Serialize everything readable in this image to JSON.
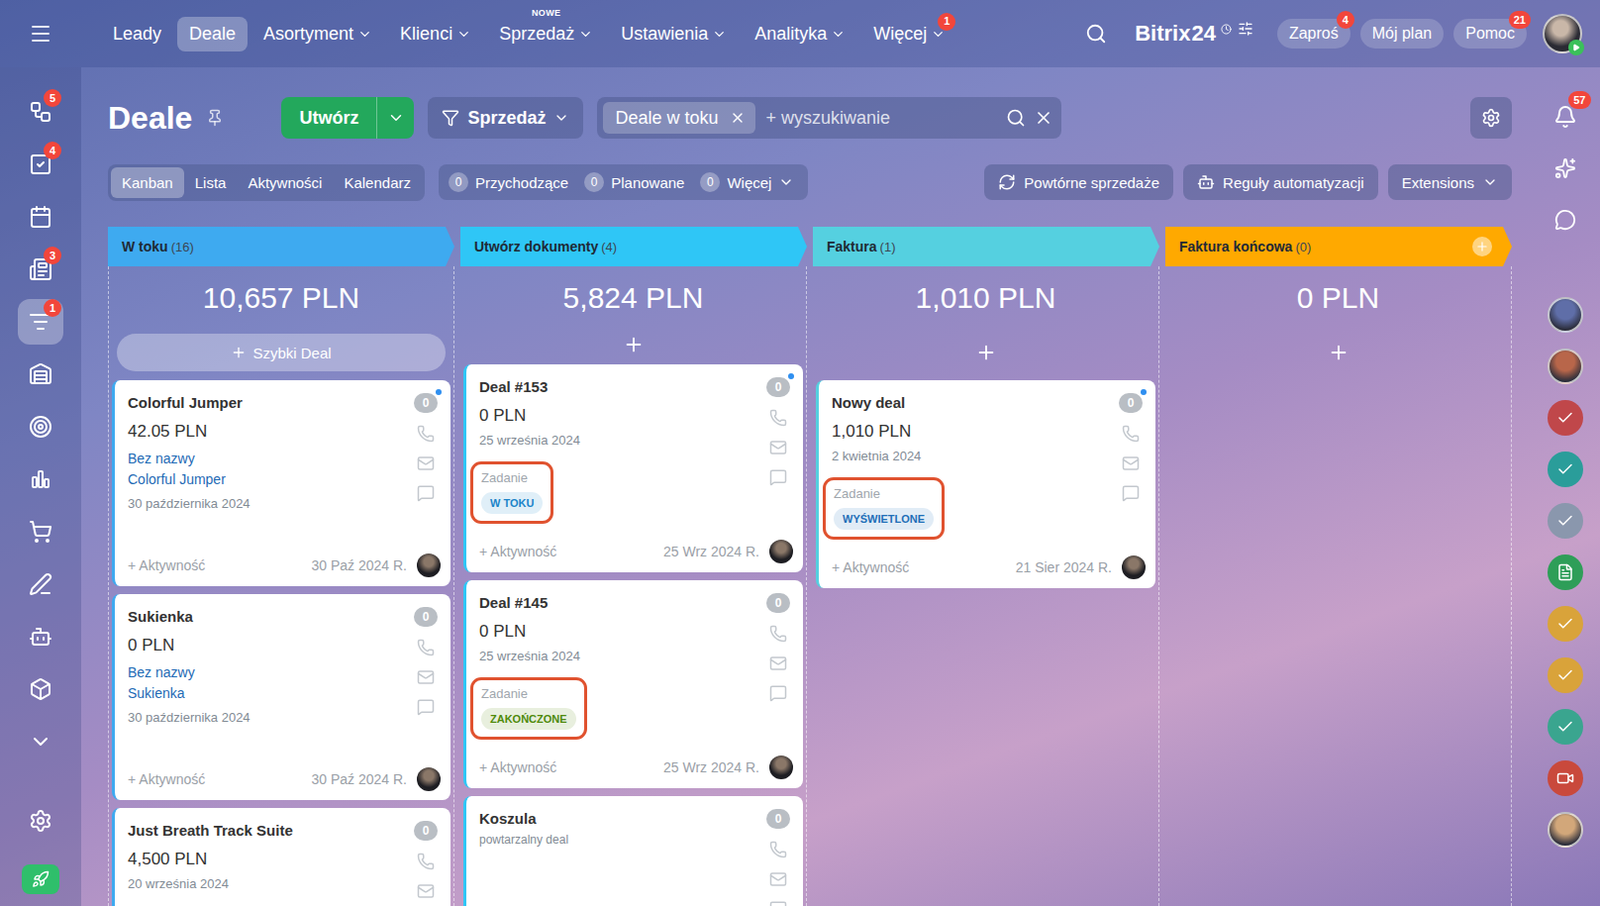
{
  "topbar": {
    "nav": [
      {
        "label": "Leady",
        "selected": false,
        "dropdown": false,
        "tag": "",
        "badge": ""
      },
      {
        "label": "Deale",
        "selected": true,
        "dropdown": false,
        "tag": "",
        "badge": ""
      },
      {
        "label": "Asortyment",
        "selected": false,
        "dropdown": true,
        "tag": "",
        "badge": ""
      },
      {
        "label": "Klienci",
        "selected": false,
        "dropdown": true,
        "tag": "",
        "badge": ""
      },
      {
        "label": "Sprzedaż",
        "selected": false,
        "dropdown": true,
        "tag": "NOWE",
        "badge": ""
      },
      {
        "label": "Ustawienia",
        "selected": false,
        "dropdown": true,
        "tag": "",
        "badge": ""
      },
      {
        "label": "Analityka",
        "selected": false,
        "dropdown": true,
        "tag": "",
        "badge": ""
      },
      {
        "label": "Więcej",
        "selected": false,
        "dropdown": true,
        "tag": "",
        "badge": "1"
      }
    ],
    "logo": {
      "name": "Bitrix",
      "number": "24"
    },
    "buttons": [
      {
        "label": "Zaproś",
        "badge": "4"
      },
      {
        "label": "Mój plan",
        "badge": ""
      },
      {
        "label": "Pomoc",
        "badge": "21"
      }
    ],
    "avatar_online": true
  },
  "sidebar": {
    "items": [
      {
        "badge": "5",
        "selected": false
      },
      {
        "badge": "4",
        "selected": false
      },
      {
        "badge": "",
        "selected": false
      },
      {
        "badge": "3",
        "selected": false
      },
      {
        "badge": "1",
        "selected": true
      },
      {
        "badge": "",
        "selected": false
      },
      {
        "badge": "",
        "selected": false
      },
      {
        "badge": "",
        "selected": false
      },
      {
        "badge": "",
        "selected": false
      },
      {
        "badge": "",
        "selected": false
      },
      {
        "badge": "",
        "selected": false
      },
      {
        "badge": "",
        "selected": false
      },
      {
        "badge": "",
        "selected": false
      }
    ]
  },
  "right_sidebar": {
    "top": [
      {
        "kind": "bell",
        "badge": "57"
      },
      {
        "kind": "copilot",
        "badge": ""
      },
      {
        "kind": "chat",
        "badge": ""
      }
    ],
    "items": [
      {
        "kind": "avatar",
        "color": "#5f6ea8"
      },
      {
        "kind": "avatar",
        "color": "#b8664a"
      },
      {
        "kind": "task",
        "color": "#c0474a"
      },
      {
        "kind": "task",
        "color": "#2a9d9a"
      },
      {
        "kind": "task",
        "color": "#8a97ad"
      },
      {
        "kind": "doc",
        "color": "#2e9e58"
      },
      {
        "kind": "task",
        "color": "#d9a33a"
      },
      {
        "kind": "task",
        "color": "#d9a33a"
      },
      {
        "kind": "task",
        "color": "#3aa58f"
      },
      {
        "kind": "video",
        "color": "#c9493c"
      },
      {
        "kind": "avatar",
        "color": "#d2a77a"
      }
    ]
  },
  "page": {
    "title": "Deale",
    "create_button": "Utwórz",
    "funnel": "Sprzedaż",
    "search": {
      "tag": "Deale w toku",
      "placeholder": "+ wyszukiwanie"
    }
  },
  "views": [
    {
      "label": "Kanban",
      "selected": true
    },
    {
      "label": "Lista",
      "selected": false
    },
    {
      "label": "Aktywności",
      "selected": false
    },
    {
      "label": "Kalendarz",
      "selected": false
    }
  ],
  "counters": [
    {
      "count": "0",
      "label": "Przychodzące",
      "dropdown": false
    },
    {
      "count": "0",
      "label": "Planowane",
      "dropdown": false
    },
    {
      "count": "0",
      "label": "Więcej",
      "dropdown": true
    }
  ],
  "actions": [
    {
      "label": "Powtórne sprzedaże",
      "kind": "repeat",
      "dropdown": false
    },
    {
      "label": "Reguły automatyzacji",
      "kind": "robot",
      "dropdown": false
    },
    {
      "label": "Extensions",
      "kind": "plain",
      "dropdown": true
    }
  ],
  "columns": [
    {
      "title": "W toku",
      "count": "(16)",
      "sum": "10,657 PLN",
      "color": "#3eaaf0",
      "quick_add": "Szybki Deal",
      "add_button": false,
      "cards": [
        {
          "title": "Colorful Jumper",
          "amount": "42.05 PLN",
          "links": [
            "Bez nazwy",
            "Colorful Jumper"
          ],
          "date": "30 października 2024",
          "activity": "+ Aktywność",
          "footer_date": "30 Paź 2024 R.",
          "counter": "0",
          "unread": true
        },
        {
          "title": "Sukienka",
          "amount": "0 PLN",
          "links": [
            "Bez nazwy",
            "Sukienka"
          ],
          "date": "30 października 2024",
          "activity": "+ Aktywność",
          "footer_date": "30 Paź 2024 R.",
          "counter": "0",
          "unread": false
        },
        {
          "title": "Just Breath Track Suite",
          "amount": "4,500 PLN",
          "links": [],
          "date": "20 września 2024",
          "counter": "0",
          "unread": false
        }
      ]
    },
    {
      "title": "Utwórz dokumenty",
      "count": "(4)",
      "sum": "5,824 PLN",
      "color": "#2fc6f6",
      "quick_add": "",
      "add_button": false,
      "cards": [
        {
          "title": "Deal #153",
          "amount": "0 PLN",
          "links": [],
          "date": "25 września 2024",
          "task": {
            "label": "Zadanie",
            "status": "W TOKU",
            "color": "#1a84c9",
            "highlighted": true
          },
          "activity": "+ Aktywność",
          "footer_date": "25 Wrz 2024 R.",
          "counter": "0",
          "unread": true
        },
        {
          "title": "Deal #145",
          "amount": "0 PLN",
          "links": [],
          "date": "25 września 2024",
          "task": {
            "label": "Zadanie",
            "status": "ZAKOŃCZONE",
            "color": "#4f8a0b",
            "highlighted": true
          },
          "activity": "+ Aktywność",
          "footer_date": "25 Wrz 2024 R.",
          "counter": "0",
          "unread": false
        },
        {
          "title": "Koszula",
          "subtitle": "powtarzalny deal",
          "links": [],
          "counter": "0",
          "unread": false
        }
      ]
    },
    {
      "title": "Faktura",
      "count": "(1)",
      "sum": "1,010 PLN",
      "color": "#55d0e0",
      "quick_add": "",
      "add_button": false,
      "cards": [
        {
          "title": "Nowy deal",
          "amount": "1,010 PLN",
          "links": [],
          "date": "2 kwietnia 2024",
          "task": {
            "label": "Zadanie",
            "status": "WYŚWIETLONE",
            "color": "#1f6fb8",
            "highlighted": true
          },
          "activity": "+ Aktywność",
          "footer_date": "21 Sier 2024 R.",
          "counter": "0",
          "unread": true
        }
      ]
    },
    {
      "title": "Faktura końcowa",
      "count": "(0)",
      "sum": "0 PLN",
      "color": "#ffa900",
      "quick_add": "",
      "add_button": true,
      "cards": []
    }
  ]
}
